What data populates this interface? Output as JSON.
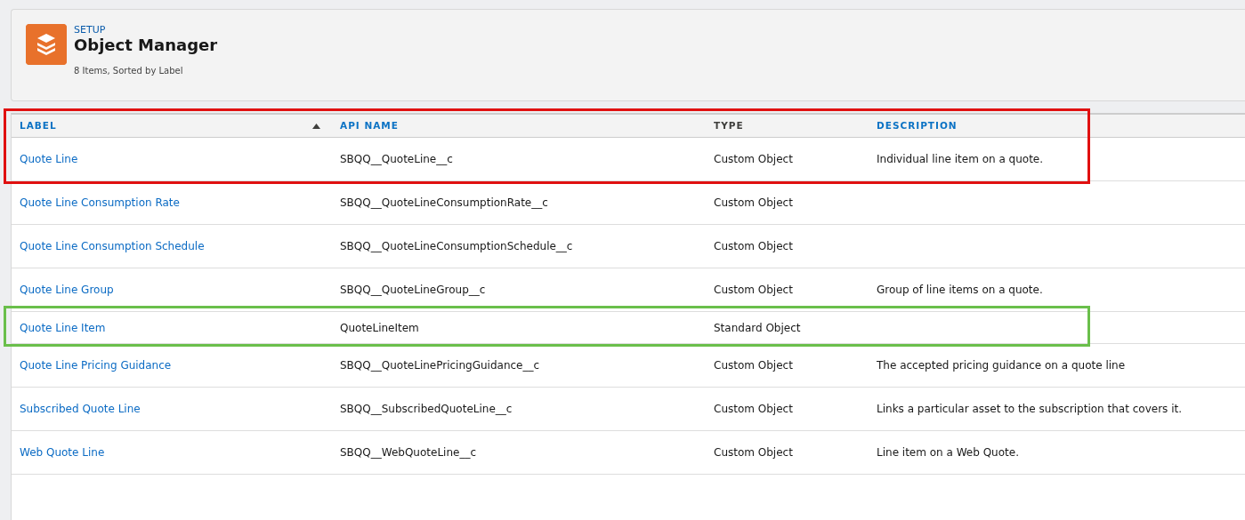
{
  "header": {
    "eyebrow": "SETUP",
    "title": "Object Manager",
    "meta": "8 Items, Sorted by Label"
  },
  "table": {
    "columns": [
      {
        "label": "LABEL",
        "sortable": true,
        "sorted": true
      },
      {
        "label": "API NAME",
        "sortable": true,
        "sorted": false
      },
      {
        "label": "TYPE",
        "sortable": false,
        "sorted": false
      },
      {
        "label": "DESCRIPTION",
        "sortable": true,
        "sorted": false
      }
    ],
    "header_row": {
      "color": "#e01010"
    },
    "rows": [
      {
        "label": "Quote Line",
        "api_name": "SBQQ__QuoteLine__c",
        "type": "Custom Object",
        "description": "Individual line item on a quote.",
        "color": "#e01010"
      },
      {
        "label": "Quote Line Consumption Rate",
        "api_name": "SBQQ__QuoteLineConsumptionRate__c",
        "type": "Custom Object"
      },
      {
        "label": "Quote Line Consumption Schedule",
        "api_name": "SBQQ__QuoteLineConsumptionSchedule__c",
        "type": "Custom Object"
      },
      {
        "label": "Quote Line Group",
        "api_name": "SBQQ__QuoteLineGroup__c",
        "type": "Custom Object",
        "description": "Group of line items on a quote."
      },
      {
        "label": "Quote Line Item",
        "api_name": "QuoteLineItem",
        "type": "Standard Object",
        "color": "#6abf4b"
      },
      {
        "label": "Quote Line Pricing Guidance",
        "api_name": "SBQQ__QuoteLinePricingGuidance__c",
        "type": "Custom Object",
        "description": "The accepted pricing guidance on a quote line"
      },
      {
        "label": "Subscribed Quote Line",
        "api_name": "SBQQ__SubscribedQuoteLine__c",
        "type": "Custom Object",
        "description": "Links a particular asset to the subscription that covers it."
      },
      {
        "label": "Web Quote Line",
        "api_name": "SBQQ__WebQuoteLine__c",
        "type": "Custom Object",
        "description": "Line item on a Web Quote."
      }
    ]
  }
}
